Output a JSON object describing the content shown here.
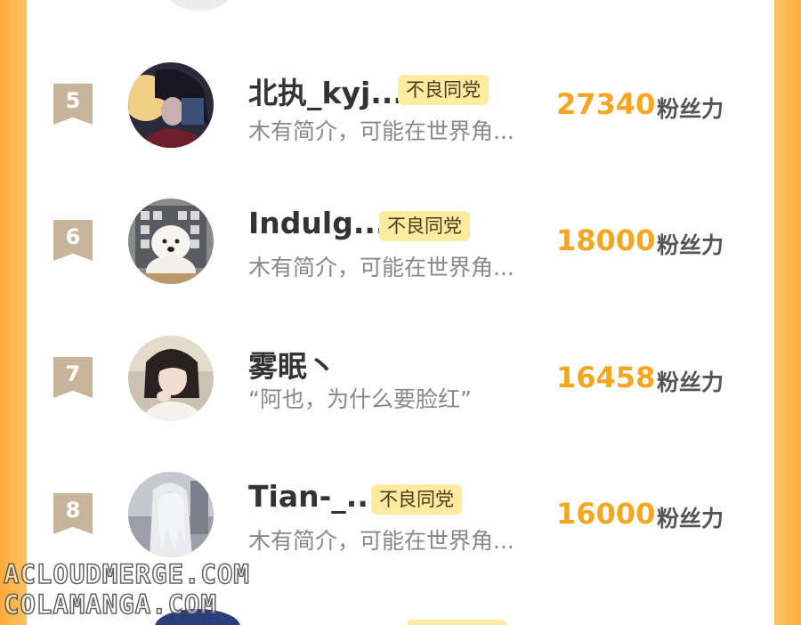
{
  "ranking": {
    "entries": [
      {
        "rank": "5",
        "name": "北执_kyj...",
        "badge": "不良同党",
        "bio": "木有简介，可能在世界角...",
        "score": "27340",
        "unit": "粉丝力"
      },
      {
        "rank": "6",
        "name": "Indulg...",
        "badge": "不良同党",
        "bio": "木有简介，可能在世界角...",
        "score": "18000",
        "unit": "粉丝力"
      },
      {
        "rank": "7",
        "name": "雾眠丶",
        "badge": "",
        "bio": "“阿也，为什么要脸红”",
        "score": "16458",
        "unit": "粉丝力"
      },
      {
        "rank": "8",
        "name": "Tian-_...",
        "badge": "不良同党",
        "bio": "木有简介，可能在世界角...",
        "score": "16000",
        "unit": "粉丝力"
      }
    ]
  },
  "watermarks": {
    "line1": "ACLOUDMERGE.COM",
    "line2": "COLAMANGA.COM"
  },
  "colors": {
    "accent_score": "#f5a623",
    "badge_bg": "#fdeca0",
    "rank_ribbon": "#c8b49b",
    "frame_orange": "#ffc062"
  }
}
